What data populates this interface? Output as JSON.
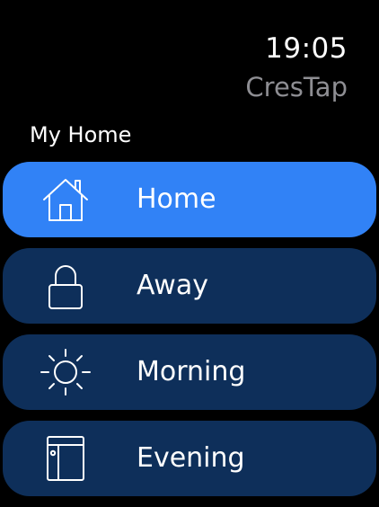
{
  "status": {
    "time": "19:05",
    "app_name": "CresTap"
  },
  "section_title": "My Home",
  "colors": {
    "active": "#3182f6",
    "inactive": "#0e2f5a",
    "secondary_text": "#8e8e93"
  },
  "scenes": [
    {
      "label": "Home",
      "icon": "house-icon",
      "selected": true
    },
    {
      "label": "Away",
      "icon": "lock-icon",
      "selected": false
    },
    {
      "label": "Morning",
      "icon": "sun-icon",
      "selected": false
    },
    {
      "label": "Evening",
      "icon": "window-icon",
      "selected": false
    }
  ]
}
